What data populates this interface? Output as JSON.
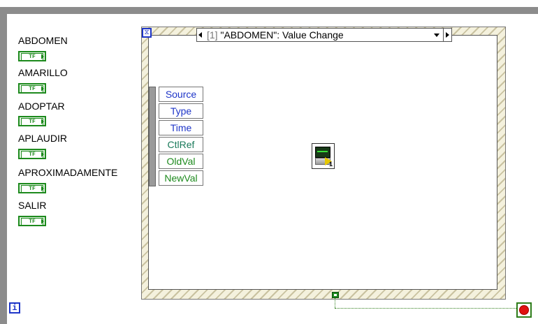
{
  "terminals": [
    {
      "label": "ABDOMEN",
      "glyph": "TF"
    },
    {
      "label": "AMARILLO",
      "glyph": "TF"
    },
    {
      "label": "ADOPTAR",
      "glyph": "TF"
    },
    {
      "label": "APLAUDIR",
      "glyph": "TF"
    },
    {
      "label": "APROXIMADAMENTE",
      "glyph": "TF"
    },
    {
      "label": "SALIR",
      "glyph": "TF"
    }
  ],
  "event_structure": {
    "case_index": "[1]",
    "case_label": "\"ABDOMEN\": Value Change",
    "data_fields": [
      "Source",
      "Type",
      "Time",
      "CtlRef",
      "OldVal",
      "NewVal"
    ],
    "field_colors": [
      "#1e35c8",
      "#1e35c8",
      "#1e35c8",
      "#1a7a5a",
      "#1d8a1d",
      "#1d8a1d"
    ]
  },
  "subvi": {
    "badge": "1",
    "icon": "waveform-monitor-icon"
  },
  "loop": {
    "iteration_glyph": "i",
    "stop_icon": "stop-terminal-icon"
  },
  "colors": {
    "boolean": "#1d8a1d",
    "wire": "#2e7d1a",
    "frame": "#8c8c8c",
    "terminal_blue": "#1e35c8"
  }
}
